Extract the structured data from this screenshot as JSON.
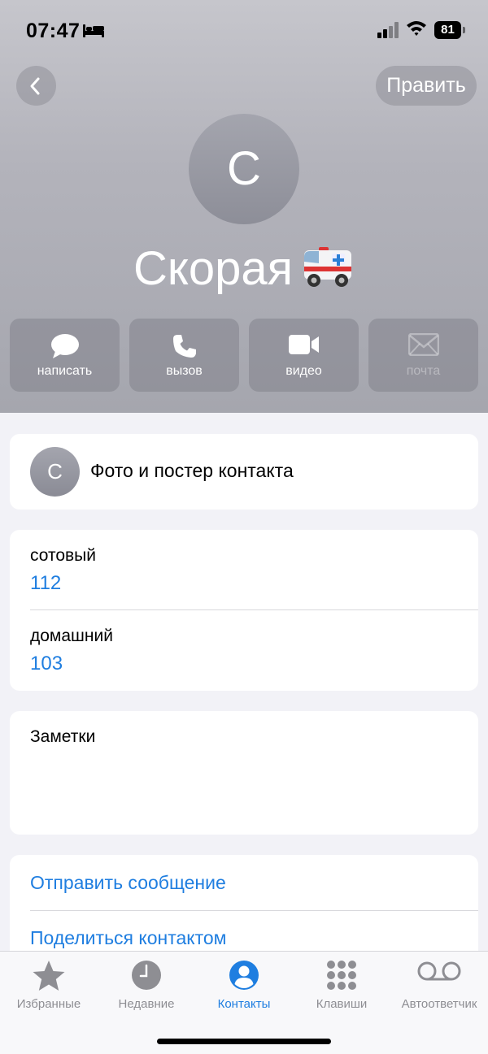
{
  "status_bar": {
    "time": "07:47",
    "battery": "81"
  },
  "header": {
    "edit_label": "Править",
    "avatar_initial": "С",
    "contact_name": "Скорая",
    "contact_emoji": "ambulance-emoji"
  },
  "actions": [
    {
      "icon": "message-icon",
      "label": "написать",
      "enabled": true
    },
    {
      "icon": "phone-icon",
      "label": "вызов",
      "enabled": true
    },
    {
      "icon": "video-icon",
      "label": "видео",
      "enabled": true
    },
    {
      "icon": "mail-icon",
      "label": "почта",
      "enabled": false
    }
  ],
  "photo_card": {
    "initial": "С",
    "label": "Фото и постер контакта"
  },
  "phones": [
    {
      "type": "сотовый",
      "number": "112"
    },
    {
      "type": "домашний",
      "number": "103"
    }
  ],
  "notes": {
    "label": "Заметки"
  },
  "links": [
    {
      "label": "Отправить сообщение"
    },
    {
      "label": "Поделиться контактом"
    }
  ],
  "tab_bar": {
    "tabs": [
      {
        "icon": "star-icon",
        "label": "Избранные",
        "active": false
      },
      {
        "icon": "clock-icon",
        "label": "Недавние",
        "active": false
      },
      {
        "icon": "person-circle-icon",
        "label": "Контакты",
        "active": true
      },
      {
        "icon": "keypad-icon",
        "label": "Клавиши",
        "active": false
      },
      {
        "icon": "voicemail-icon",
        "label": "Автоответчик",
        "active": false
      }
    ]
  },
  "colors": {
    "accent": "#1f7ee0",
    "inactive_tab": "#8e8e93",
    "background": "#f2f2f7"
  }
}
